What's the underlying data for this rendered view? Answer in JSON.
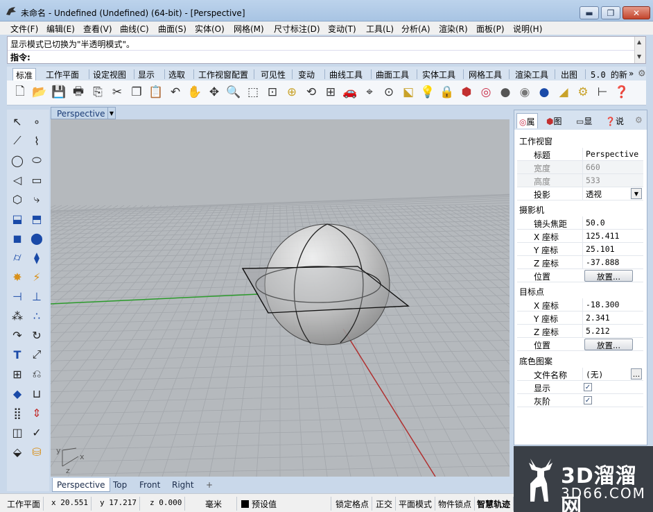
{
  "window": {
    "title": "未命名 - Undefined (Undefined) (64-bit) - [Perspective]",
    "minimize": "▬",
    "maximize": "❐",
    "close": "✕"
  },
  "menu": [
    "文件(F)",
    "编辑(E)",
    "查看(V)",
    "曲线(C)",
    "曲面(S)",
    "实体(O)",
    "网格(M)",
    "尺寸标注(D)",
    "变动(T)",
    "工具(L)",
    "分析(A)",
    "渲染(R)",
    "面板(P)",
    "说明(H)"
  ],
  "command": {
    "history": "显示模式已切换为\"半透明模式\"。",
    "prompt": "指令:",
    "scroll_up": "▲",
    "scroll_down": "▼"
  },
  "toolbar_tabs": [
    "标准",
    "工作平面",
    "设定视图",
    "显示",
    "选取",
    "工作视窗配置",
    "可见性",
    "变动",
    "曲线工具",
    "曲面工具",
    "实体工具",
    "网格工具",
    "渲染工具",
    "出图",
    "5.0 的新"
  ],
  "toolbar_tab_more": "»",
  "viewport": {
    "title": "Perspective",
    "dropdown": "▼",
    "axis_x": "x",
    "axis_y": "y",
    "axis_z": "z"
  },
  "bottom_tabs": [
    "Perspective",
    "Top",
    "Front",
    "Right"
  ],
  "bottom_tab_add": "+",
  "panel": {
    "tabs": [
      "属",
      "图",
      "显",
      "说"
    ],
    "sections": {
      "viewport": "工作视窗",
      "camera": "摄影机",
      "target": "目标点",
      "wallpaper": "底色图案"
    },
    "viewport_rows": [
      {
        "key": "标题",
        "value": "Perspective"
      },
      {
        "key": "宽度",
        "value": "660"
      },
      {
        "key": "高度",
        "value": "533"
      },
      {
        "key": "投影",
        "value": "透视"
      }
    ],
    "camera_rows": [
      {
        "key": "镜头焦距",
        "value": "50.0"
      },
      {
        "key": "X 座标",
        "value": "125.411"
      },
      {
        "key": "Y 座标",
        "value": "25.101"
      },
      {
        "key": "Z 座标",
        "value": "-37.888"
      },
      {
        "key": "位置",
        "value": "放置..."
      }
    ],
    "target_rows": [
      {
        "key": "X 座标",
        "value": "-18.300"
      },
      {
        "key": "Y 座标",
        "value": "2.341"
      },
      {
        "key": "Z 座标",
        "value": "5.212"
      },
      {
        "key": "位置",
        "value": "放置..."
      }
    ],
    "wallpaper_rows": [
      {
        "key": "文件名称",
        "value": "(无)"
      },
      {
        "key": "显示",
        "value": "✓"
      },
      {
        "key": "灰阶",
        "value": "✓"
      }
    ],
    "browse": "..."
  },
  "status": {
    "cplane": "工作平面",
    "x": "x 20.551",
    "y": "y 17.217",
    "z": "z 0.000",
    "units": "毫米",
    "layer": "预设值",
    "snap": "锁定格点",
    "ortho": "正交",
    "planar": "平面模式",
    "osnap": "物件锁点",
    "smarttrack": "智慧轨迹"
  },
  "watermark": {
    "line1": "3D溜溜网",
    "line2": "3D66.COM"
  },
  "colors": {
    "viewport_bg": "#b5b9bd",
    "grid": "#a2a6ab",
    "x_axis": "#b03030",
    "y_axis": "#2a9a2a",
    "accent": "#1a3b75"
  }
}
